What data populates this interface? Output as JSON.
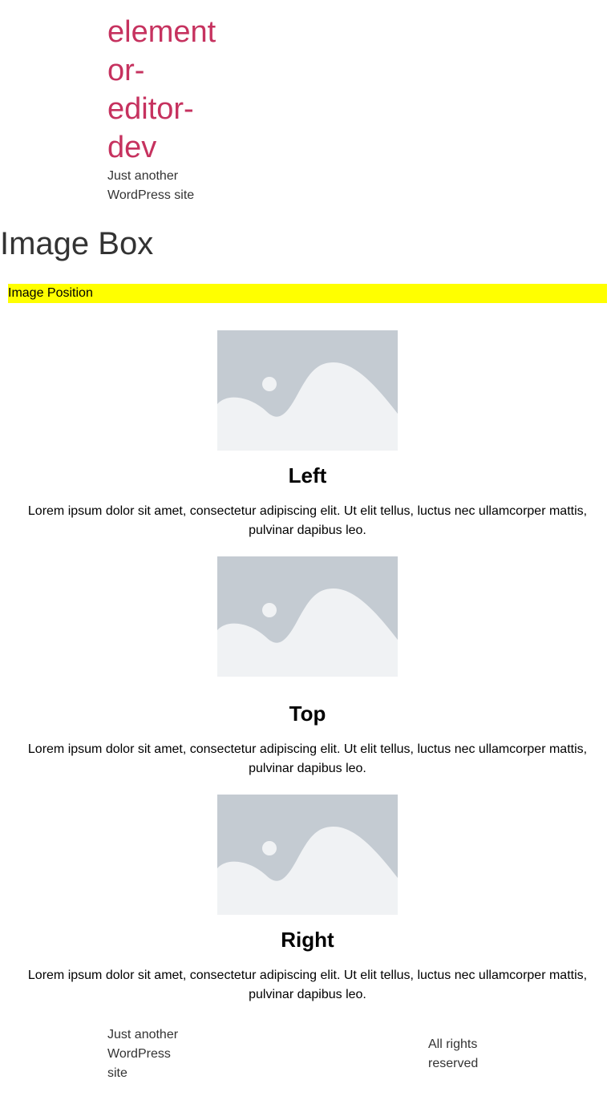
{
  "header": {
    "site_title": "element or-editor-dev",
    "tagline": "Just another WordPress site"
  },
  "page": {
    "title": "Image Box",
    "section_label": "Image Position"
  },
  "image_boxes": [
    {
      "title": "Left",
      "description": "Lorem ipsum dolor sit amet, consectetur adipiscing elit. Ut elit tellus, luctus nec ullamcorper mattis, pulvinar dapibus leo."
    },
    {
      "title": "Top",
      "description": "Lorem ipsum dolor sit amet, consectetur adipiscing elit. Ut elit tellus, luctus nec ullamcorper mattis, pulvinar dapibus leo."
    },
    {
      "title": "Right",
      "description": "Lorem ipsum dolor sit amet, consectetur adipiscing elit. Ut elit tellus, luctus nec ullamcorper mattis, pulvinar dapibus leo."
    }
  ],
  "footer": {
    "tagline": "Just another WordPress site",
    "rights": "All rights reserved"
  },
  "colors": {
    "site_title": "#c6325f",
    "section_bar": "#ffff00",
    "placeholder_bg": "#c4cbd2",
    "placeholder_fg": "#f0f2f4"
  },
  "icons": {
    "image_placeholder": "image-placeholder-icon"
  }
}
